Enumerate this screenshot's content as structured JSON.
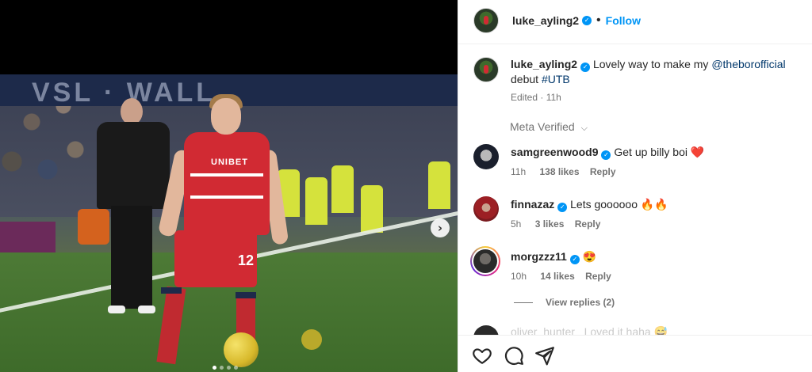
{
  "post": {
    "author": "luke_ayling2",
    "follow_label": "Follow",
    "separator": "•",
    "media": {
      "shirt_sponsor": "UNIBET",
      "shirt_number": "12",
      "carousel_dots": 4,
      "active_dot": 1
    },
    "caption": {
      "username": "luke_ayling2",
      "text_before": "Lovely way to make my",
      "mention": "@theborofficial",
      "text_after": "debut",
      "hashtag": "#UTB",
      "edited_time": "Edited · 11h"
    },
    "meta_verified_label": "Meta Verified"
  },
  "comments": [
    {
      "username": "samgreenwood9",
      "text": "Get up billy boi",
      "emoji": "❤️",
      "time": "11h",
      "likes": "138 likes",
      "reply": "Reply"
    },
    {
      "username": "finnazaz",
      "text": "Lets goooooo",
      "emoji": "🔥🔥",
      "time": "5h",
      "likes": "3 likes",
      "reply": "Reply"
    },
    {
      "username": "morgzzz11",
      "text": "",
      "emoji": "😍",
      "time": "10h",
      "likes": "14 likes",
      "reply": "Reply"
    }
  ],
  "view_replies_label": "View replies (2)",
  "partial_comment": "oliver_hunter_  Loved it haha 😅",
  "colors": {
    "accent": "#0095f6",
    "verified": "#0095f6",
    "text": "#262626",
    "muted": "#737373"
  },
  "icons": [
    "heart-icon",
    "comment-icon",
    "share-icon",
    "next-arrow-icon",
    "verified-badge-icon",
    "chevron-down-icon"
  ]
}
